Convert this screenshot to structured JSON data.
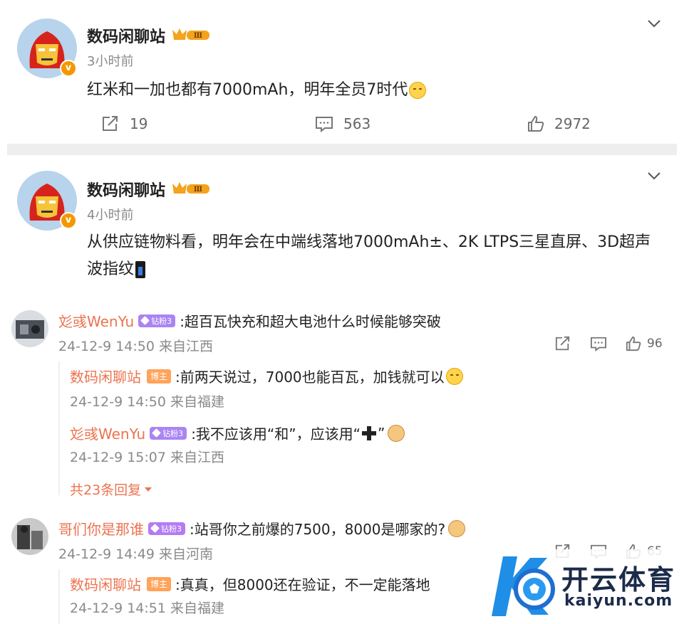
{
  "posts": [
    {
      "username": "数码闲聊站",
      "level_badge": "Ⅲ",
      "time": "3小时前",
      "text": "红米和一加也都有7000mAh，明年全员7时代",
      "reposts": "19",
      "comments": "563",
      "likes": "2972"
    },
    {
      "username": "数码闲聊站",
      "level_badge": "Ⅲ",
      "time": "4小时前",
      "text_line1": "从供应链物料看，明年会在中端线落地7000mAh±、2K LTPS三星直屏、3D超声",
      "text_line2": "波指纹"
    }
  ],
  "comments": [
    {
      "name": "彣彧WenYu",
      "badge": "钻粉3",
      "text": ":超百瓦快充和超大电池什么时候能够突破",
      "meta": "24-12-9 14:50 来自江西",
      "likes": "96",
      "replies": [
        {
          "name": "数码闲聊站",
          "badge": "博主",
          "text": ":前两天说过，7000也能百瓦，加钱就可以",
          "meta": "24-12-9 14:50 来自福建"
        },
        {
          "name": "彣彧WenYu",
          "badge": "钻粉3",
          "text_a": ":我不应该用“和”，应该用“",
          "text_b": "”",
          "meta": "24-12-9 15:07 来自江西"
        }
      ],
      "more_replies": "共23条回复"
    },
    {
      "name": "哥们你是那谁",
      "badge": "钻粉3",
      "text": ":站哥你之前爆的7500，8000是哪家的?",
      "meta": "24-12-9 14:49 来自河南",
      "likes": "65",
      "replies": [
        {
          "name": "数码闲聊站",
          "badge": "博主",
          "text": ":真真，但8000还在验证，不一定能落地",
          "meta": "24-12-9 14:51 来自福建"
        }
      ]
    }
  ],
  "watermark": {
    "title": "开云体育",
    "sub": "kaiyun.com"
  },
  "colors": {
    "accent": "#eb7350",
    "verified": "#f39800",
    "fan_badge": "#a985f3",
    "blogger_badge": "#ffa35a",
    "separator": "#eeeeee"
  },
  "icons": [
    "chevron-down-icon",
    "repost-icon",
    "comment-icon",
    "like-icon",
    "share-icon",
    "caret-down-icon"
  ]
}
